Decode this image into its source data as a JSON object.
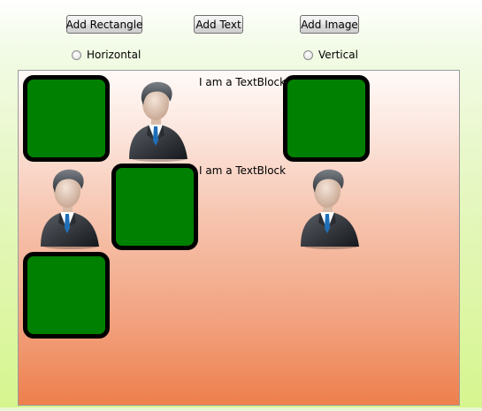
{
  "toolbar": {
    "add_rectangle": "Add Rectangle",
    "add_text": "Add Text",
    "add_image": "Add Image"
  },
  "orientation": {
    "horizontal": "Horizontal",
    "vertical": "Vertical",
    "selected": null
  },
  "panel": {
    "textblocks": [
      "I am a TextBlock",
      "I am a TextBlock"
    ],
    "item_icons": [
      "person-icon"
    ],
    "colors": {
      "rectangle_fill": "#008000",
      "rectangle_border": "#000000"
    }
  }
}
